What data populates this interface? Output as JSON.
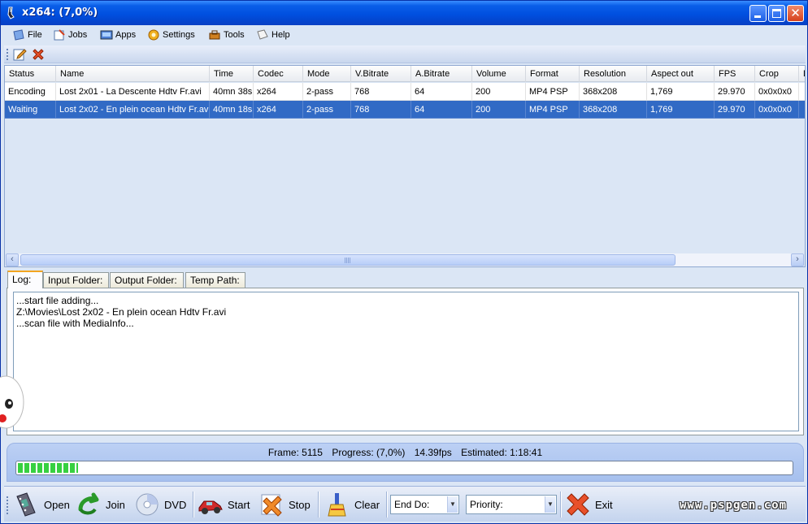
{
  "window": {
    "title": "x264: (7,0%)"
  },
  "menu": [
    {
      "label": "File",
      "icon": "file-icon"
    },
    {
      "label": "Jobs",
      "icon": "jobs-icon"
    },
    {
      "label": "Apps",
      "icon": "apps-icon"
    },
    {
      "label": "Settings",
      "icon": "settings-icon"
    },
    {
      "label": "Tools",
      "icon": "tools-icon"
    },
    {
      "label": "Help",
      "icon": "help-icon"
    }
  ],
  "grid": {
    "columns": [
      "Status",
      "Name",
      "Time",
      "Codec",
      "Mode",
      "V.Bitrate",
      "A.Bitrate",
      "Volume",
      "Format",
      "Resolution",
      "Aspect out",
      "FPS",
      "Crop",
      "D"
    ],
    "rows": [
      [
        "Encoding",
        "Lost 2x01 - La Descente Hdtv Fr.avi",
        "40mn 38s",
        "x264",
        "2-pass",
        "768",
        "64",
        "200",
        "MP4 PSP",
        "368x208",
        "1,769",
        "29.970",
        "0x0x0x0",
        ""
      ],
      [
        "Waiting",
        "Lost 2x02 - En plein ocean Hdtv Fr.avi",
        "40mn 18s",
        "x264",
        "2-pass",
        "768",
        "64",
        "200",
        "MP4 PSP",
        "368x208",
        "1,769",
        "29.970",
        "0x0x0x0",
        ""
      ]
    ],
    "selected_row": 1
  },
  "tabs": [
    {
      "label": "Log:",
      "active": true
    },
    {
      "label": "Input Folder:",
      "active": false
    },
    {
      "label": "Output Folder:",
      "active": false
    },
    {
      "label": "Temp Path:",
      "active": false
    }
  ],
  "log": {
    "lines": [
      "...start file adding...",
      "Z:\\Movies\\Lost 2x02 - En plein ocean Hdtv Fr.avi",
      "...scan file with MediaInfo..."
    ]
  },
  "status": {
    "frame": "Frame: 5115",
    "progress": "Progress: (7,0%)",
    "fps": "14.39fps",
    "estimated": "Estimated: 1:18:41",
    "progress_fraction": 0.078
  },
  "bottom": {
    "open": "Open",
    "join": "Join",
    "dvd": "DVD",
    "start": "Start",
    "stop": "Stop",
    "clear": "Clear",
    "end_do": "End Do:",
    "priority": "Priority:",
    "exit": "Exit"
  },
  "watermark": "www.pspgen.com",
  "colors": {
    "title": "#0050e0",
    "selection": "#316ac5",
    "progress": "#37d040",
    "panel": "#dbe6f5"
  }
}
